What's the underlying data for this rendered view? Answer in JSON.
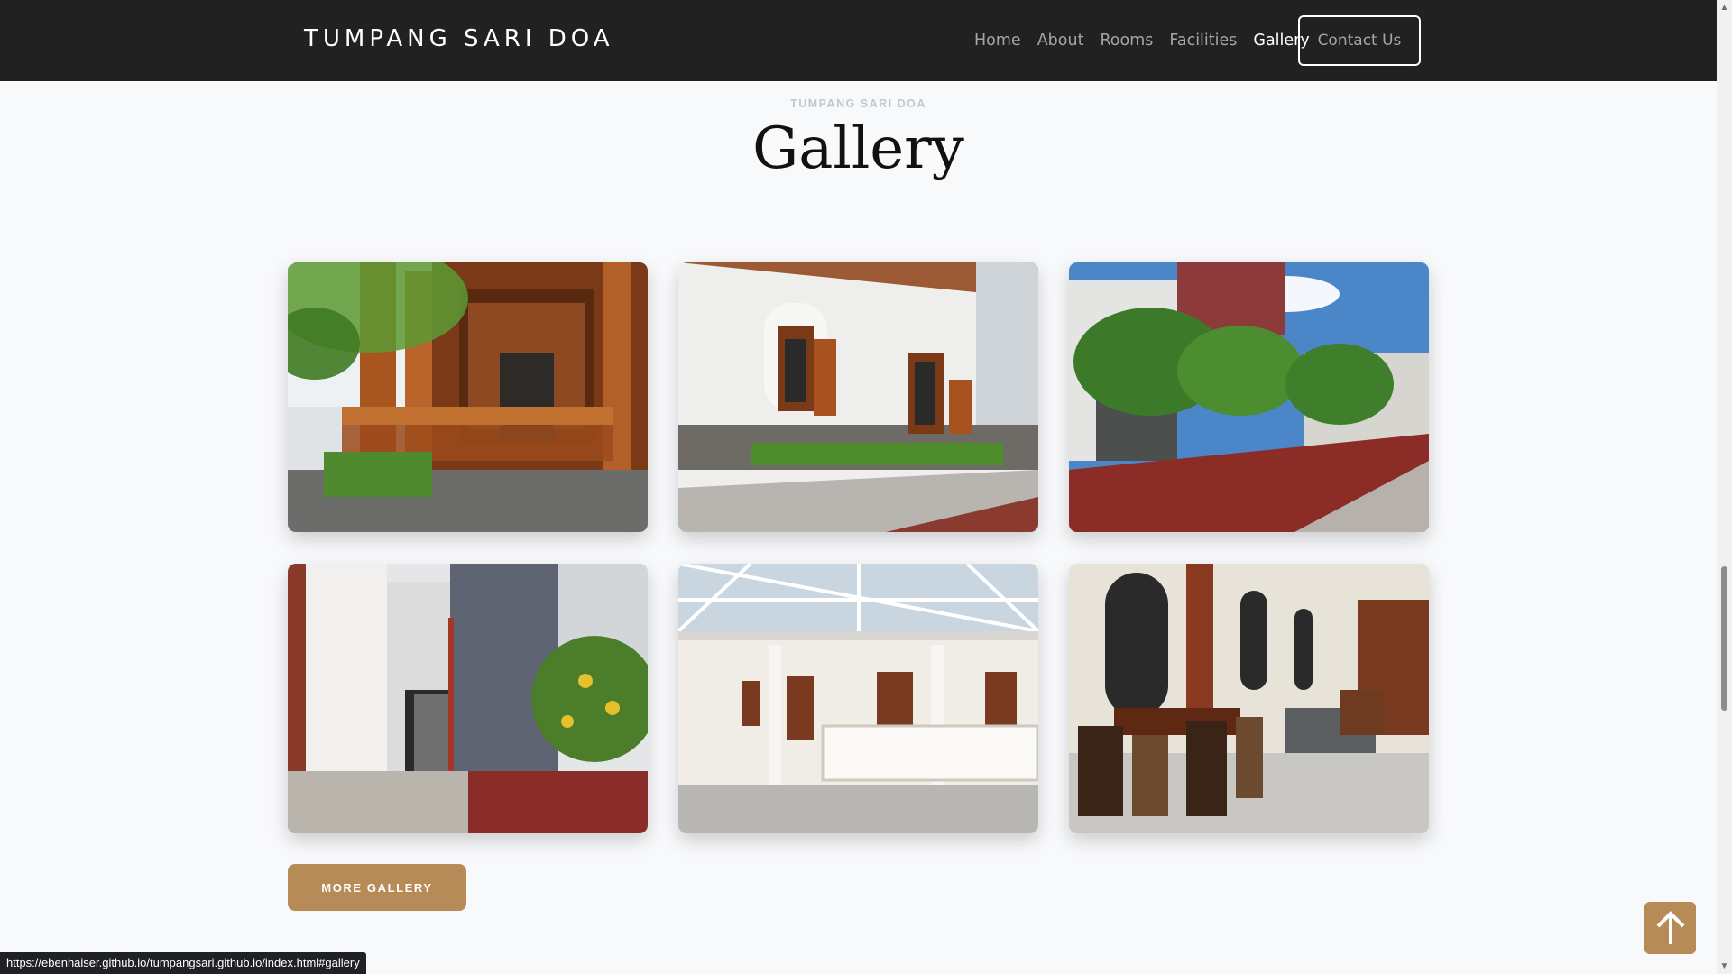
{
  "navbar": {
    "brand": "TUMPANG SARI DOA",
    "links": [
      {
        "label": "Home"
      },
      {
        "label": "About"
      },
      {
        "label": "Rooms"
      },
      {
        "label": "Facilities"
      },
      {
        "label": "Gallery",
        "active": true
      }
    ],
    "contact_label": "Contact Us"
  },
  "section": {
    "eyebrow": "TUMPANG SARI DOA",
    "title": "Gallery"
  },
  "gallery": {
    "images": [
      {
        "name": "wooden-pendopo-photo"
      },
      {
        "name": "white-house-arched-windows-photo"
      },
      {
        "name": "courtyard-frangipani-photo"
      },
      {
        "name": "side-entrance-photo"
      },
      {
        "name": "glass-roof-hall-photo"
      },
      {
        "name": "dining-living-room-photo"
      }
    ],
    "more_label": "MORE GALLERY"
  },
  "back_to_top_icon": "arrow-up-icon",
  "status_bar": {
    "url": "https://ebenhaiser.github.io/tumpangsari.github.io/index.html#gallery"
  },
  "colors": {
    "navbar_bg": "#212121",
    "accent": "#b68b57",
    "page_bg": "#f8f9fb"
  }
}
